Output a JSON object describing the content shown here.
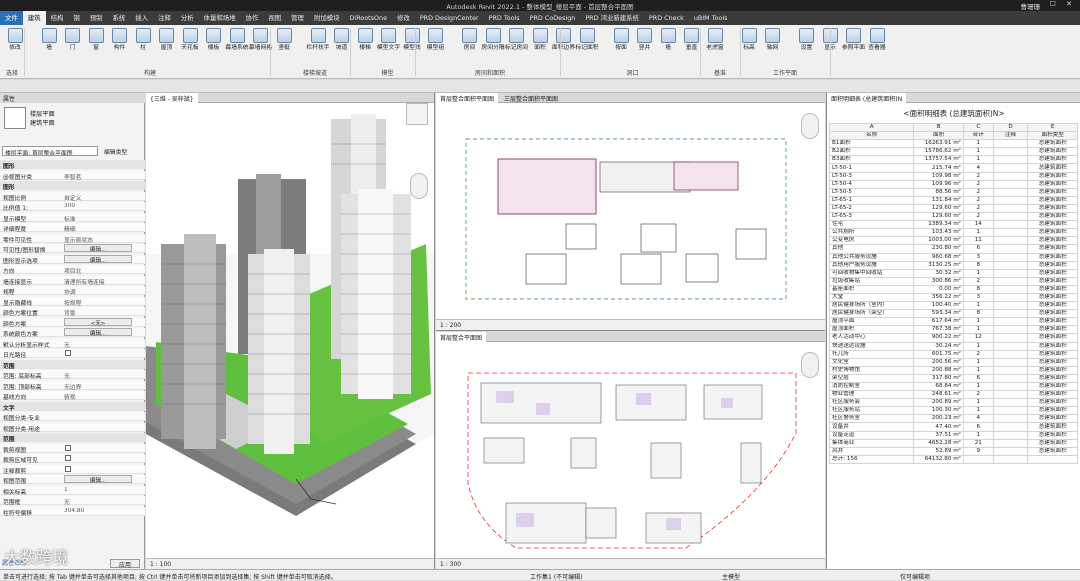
{
  "title_bar": {
    "title": "Autodesk Revit 2022.1 - 整体模型_楼层平面 - 首层整合平面图",
    "user": "曹珊珊"
  },
  "tabs": [
    "文件",
    "建筑",
    "结构",
    "钢",
    "预制",
    "系统",
    "插入",
    "注释",
    "分析",
    "体量和场地",
    "协作",
    "视图",
    "管理",
    "附加模块",
    "DiRootsOne",
    "修改",
    "PRD DesignCenter",
    "PRD Tools",
    "PRD CoDesign",
    "PRD 鸿业新建系统",
    "PRD Check",
    "uBIM Tools"
  ],
  "ribbon": {
    "buttons": [
      "修改",
      "墙",
      "门",
      "窗",
      "构件",
      "柱",
      "屋顶",
      "天花板",
      "楼板",
      "幕墙系统",
      "幕墙网格",
      "竖梃",
      "栏杆扶手",
      "坡道",
      "楼梯",
      "模型文字",
      "模型线",
      "模型组",
      "房间",
      "房间分隔",
      "标记房间",
      "面积",
      "面积边界",
      "标记面积",
      "按面",
      "竖井",
      "墙",
      "垂直",
      "老虎窗",
      "标高",
      "轴网",
      "设置",
      "显示",
      "参照平面",
      "查看器"
    ],
    "groups": [
      "选择",
      "构建",
      "楼梯坡道",
      "模型",
      "房间和面积",
      "洞口",
      "基准",
      "工作平面"
    ]
  },
  "properties": {
    "header": "属性",
    "type_line1": "楼层平面",
    "type_line2": "建筑平面",
    "selector": "楼层平面: 首层整合平面图",
    "edit_type": "编辑类型",
    "rows": [
      {
        "k": "图形",
        "v": "",
        "sec": true
      },
      {
        "k": "@视图分类",
        "v": "李智茗"
      },
      {
        "k": "图形",
        "v": "",
        "sec": true
      },
      {
        "k": "视图比例",
        "v": "自定义"
      },
      {
        "k": "比例值 1:",
        "v": "300"
      },
      {
        "k": "显示模型",
        "v": "标准"
      },
      {
        "k": "详细程度",
        "v": "精细"
      },
      {
        "k": "零件可见性",
        "v": "显示原状态"
      },
      {
        "k": "可见性/图形替换",
        "v": "编辑...",
        "btn": true
      },
      {
        "k": "图形显示选项",
        "v": "编辑...",
        "btn": true
      },
      {
        "k": "方向",
        "v": "项目北"
      },
      {
        "k": "墙连接显示",
        "v": "清理所有墙连接"
      },
      {
        "k": "规程",
        "v": "协调"
      },
      {
        "k": "显示隐藏线",
        "v": "按规程"
      },
      {
        "k": "颜色方案位置",
        "v": "背景"
      },
      {
        "k": "颜色方案",
        "v": "<无>",
        "btn": true
      },
      {
        "k": "系统颜色方案",
        "v": "编辑...",
        "btn": true
      },
      {
        "k": "默认分析显示样式",
        "v": "无"
      },
      {
        "k": "日光路径",
        "v": "",
        "cb": true
      },
      {
        "k": "范围",
        "v": "",
        "sec": true
      },
      {
        "k": "范围: 底部标高",
        "v": "无"
      },
      {
        "k": "范围: 顶部标高",
        "v": "无边界"
      },
      {
        "k": "基线方向",
        "v": "俯视"
      },
      {
        "k": "文字",
        "v": "",
        "sec": true
      },
      {
        "k": "视图分类-专业",
        "v": ""
      },
      {
        "k": "视图分类-用途",
        "v": ""
      },
      {
        "k": "范围",
        "v": "",
        "sec": true
      },
      {
        "k": "裁剪视图",
        "v": "",
        "cb": true
      },
      {
        "k": "裁剪区域可见",
        "v": "",
        "cb": true
      },
      {
        "k": "注释裁剪",
        "v": "",
        "cb": true
      },
      {
        "k": "视图范围",
        "v": "编辑...",
        "btn": true
      },
      {
        "k": "相关标高",
        "v": "1"
      },
      {
        "k": "范围框",
        "v": "无"
      },
      {
        "k": "柱符号偏移",
        "v": "304.80"
      }
    ],
    "help": "属性帮助",
    "apply": "应用"
  },
  "views": {
    "view3d_title": "{三维 - 吴梓斌}",
    "viewA_tabs": [
      "首层整合面积平面图",
      "三层整合面积平面图"
    ],
    "viewB_tab": "首层整合平面图",
    "scale3d": "1 : 100",
    "scaleA": "1 : 200",
    "scaleB": "1 : 300"
  },
  "schedule": {
    "tab": "面积明细表 (总建筑面积)N",
    "title": "<面积明细表 (总建筑面积)N>",
    "col_letters": [
      "A",
      "B",
      "C",
      "D",
      "E"
    ],
    "columns": [
      "名称",
      "面积",
      "合计",
      "注释",
      "面积类型"
    ],
    "rows": [
      [
        "B1面积",
        "16263.91 m²",
        "1",
        "",
        "总建筑面积"
      ],
      [
        "B2面积",
        "15786.62 m²",
        "1",
        "",
        "总建筑面积"
      ],
      [
        "B3面积",
        "13757.54 m²",
        "1",
        "",
        "总建筑面积"
      ],
      [
        "LT-50-1",
        "215.74 m²",
        "4",
        "",
        "总建筑面积"
      ],
      [
        "LT-50-3",
        "109.98 m²",
        "2",
        "",
        "总建筑面积"
      ],
      [
        "LT-50-4",
        "109.96 m²",
        "2",
        "",
        "总建筑面积"
      ],
      [
        "LT-50-5",
        "88.56 m²",
        "2",
        "",
        "总建筑面积"
      ],
      [
        "LT-65-1",
        "131.84 m²",
        "2",
        "",
        "总建筑面积"
      ],
      [
        "LT-65-2",
        "129.60 m²",
        "2",
        "",
        "总建筑面积"
      ],
      [
        "LT-65-3",
        "129.60 m²",
        "2",
        "",
        "总建筑面积"
      ],
      [
        "住宅",
        "1389.34 m²",
        "14",
        "",
        "总建筑面积"
      ],
      [
        "公共厕所",
        "103.43 m²",
        "1",
        "",
        "总建筑面积"
      ],
      [
        "公变电房",
        "1003.00 m²",
        "11",
        "",
        "总建筑面积"
      ],
      [
        "其他",
        "230.80 m²",
        "6",
        "",
        "总建筑面积"
      ],
      [
        "其他公共服务设施",
        "960.68 m²",
        "3",
        "",
        "总建筑面积"
      ],
      [
        "其他用户服务设施",
        "3130.25 m²",
        "8",
        "",
        "总建筑面积"
      ],
      [
        "可回收物集中回收站",
        "30.32 m²",
        "1",
        "",
        "总建筑面积"
      ],
      [
        "垃圾收集站",
        "300.86 m²",
        "2",
        "",
        "总建筑面积"
      ],
      [
        "基座面积",
        "0.00 m²",
        "8",
        "",
        "总建筑面积"
      ],
      [
        "大堂",
        "356.22 m²",
        "3",
        "",
        "总建筑面积"
      ],
      [
        "居民健身场所（室内）",
        "100.40 m²",
        "1",
        "",
        "总建筑面积"
      ],
      [
        "居民健身场所（架空）",
        "593.34 m²",
        "8",
        "",
        "总建筑面积"
      ],
      [
        "屋顶平面",
        "617.64 m²",
        "1",
        "",
        "总建筑面积"
      ],
      [
        "屋顶面积",
        "767.38 m²",
        "1",
        "",
        "总建筑面积"
      ],
      [
        "老人活动中心",
        "900.22 m²",
        "12",
        "",
        "总建筑面积"
      ],
      [
        "快递送达设施",
        "30.24 m²",
        "1",
        "",
        "总建筑面积"
      ],
      [
        "托儿所",
        "601.75 m²",
        "2",
        "",
        "总建筑面积"
      ],
      [
        "文化室",
        "200.56 m²",
        "1",
        "",
        "总建筑面积"
      ],
      [
        "村史博物馆",
        "200.88 m²",
        "1",
        "",
        "总建筑面积"
      ],
      [
        "架空层",
        "317.80 m²",
        "6",
        "",
        "总建筑面积"
      ],
      [
        "消防控制室",
        "68.84 m²",
        "1",
        "",
        "总建筑面积"
      ],
      [
        "物业管理",
        "248.61 m²",
        "2",
        "",
        "总建筑面积"
      ],
      [
        "社区服务会",
        "200.89 m²",
        "1",
        "",
        "总建筑面积"
      ],
      [
        "社区服务站",
        "100.30 m²",
        "1",
        "",
        "总建筑面积"
      ],
      [
        "社区警务室",
        "200.23 m²",
        "4",
        "",
        "总建筑面积"
      ],
      [
        "设备井",
        "47.40 m²",
        "6",
        "",
        "总建筑面积"
      ],
      [
        "设备走道",
        "37.51 m²",
        "1",
        "",
        "总建筑面积"
      ],
      [
        "集体商业",
        "4652.28 m²",
        "21",
        "",
        "总建筑面积"
      ],
      [
        "风井",
        "52.89 m²",
        "9",
        "",
        "总建筑面积"
      ],
      [
        "总计: 156",
        "64132.80 m²",
        "",
        "",
        ""
      ]
    ]
  },
  "status": {
    "text": "单击可进行选择; 按 Tab 键并单击可选择其他项目; 按 Ctrl 键并单击可将新项目添加到选择集; 按 Shift 键并单击可取消选择。",
    "workset": "工作集1 (不可编辑)",
    "design_option": "主模型",
    "editable_only": "仅可编辑项"
  },
  "watermark": "大数跨境"
}
